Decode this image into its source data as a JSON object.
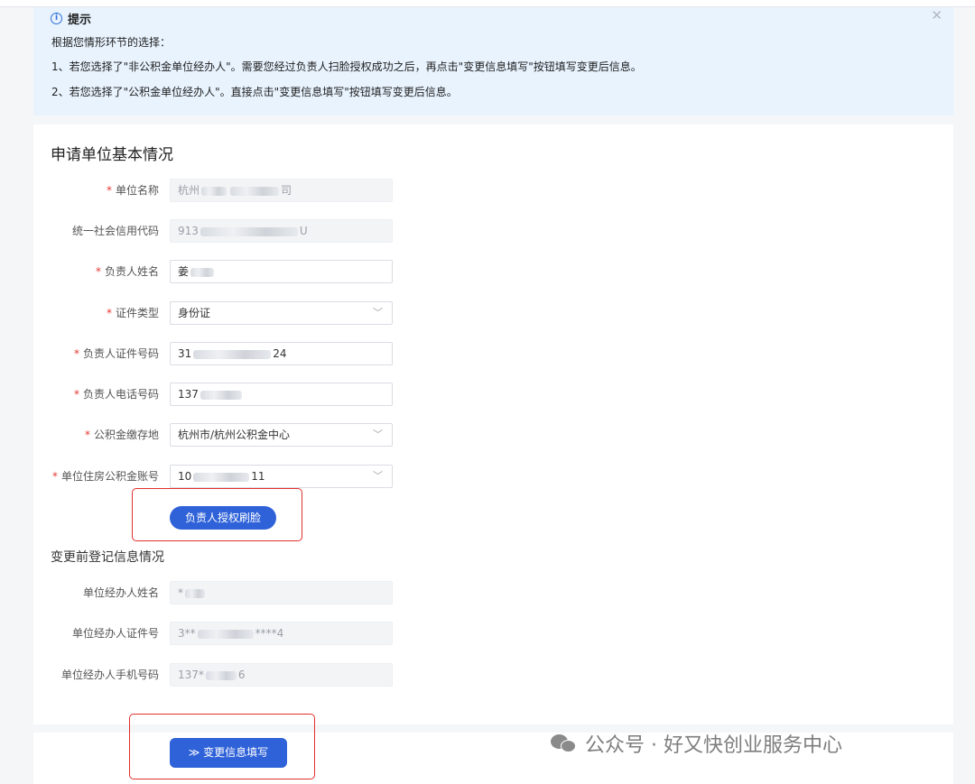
{
  "tip": {
    "title": "提示",
    "intro": "根据您情形环节的选择：",
    "line1": "1、若您选择了\"非公积金单位经办人\"。需要您经过负责人扫脸授权成功之后，再点击\"变更信息填写\"按钮填写变更后信息。",
    "line2": "2、若您选择了\"公积金单位经办人\"。直接点击\"变更信息填写\"按钮填写变更后信息。",
    "close_icon": "close-icon"
  },
  "section1": {
    "title": "申请单位基本情况"
  },
  "form": {
    "unit_name": {
      "label": "单位名称",
      "prefix": "杭州",
      "suffix": "司"
    },
    "credit_code": {
      "label": "统一社会信用代码",
      "prefix": "913",
      "suffix": "U"
    },
    "leader_name": {
      "label": "负责人姓名",
      "prefix": "姜"
    },
    "id_type": {
      "label": "证件类型",
      "value": "身份证"
    },
    "leader_id": {
      "label": "负责人证件号码",
      "prefix": "31",
      "suffix": "24"
    },
    "leader_phone": {
      "label": "负责人电话号码",
      "prefix": "137"
    },
    "fund_location": {
      "label": "公积金缴存地",
      "value": "杭州市/杭州公积金中心"
    },
    "fund_account": {
      "label": "单位住房公积金账号",
      "prefix": "10",
      "suffix": "11"
    }
  },
  "auth_button": {
    "label": "负责人授权刷脸"
  },
  "section2": {
    "title": "变更前登记信息情况"
  },
  "before": {
    "agent_name": {
      "label": "单位经办人姓名",
      "prefix": "*"
    },
    "agent_id": {
      "label": "单位经办人证件号",
      "prefix": "3**",
      "suffix": "****4"
    },
    "agent_phone": {
      "label": "单位经办人手机号码",
      "prefix": "137*",
      "suffix": "6"
    }
  },
  "change_button": {
    "label": "≫ 变更信息填写"
  },
  "watermark": {
    "text": "公众号 · 好又快创业服务中心"
  },
  "colors": {
    "primary": "#2f62d8",
    "tip_bg": "#e8f3fe",
    "required": "#e53935",
    "highlight": "#e0312e"
  }
}
